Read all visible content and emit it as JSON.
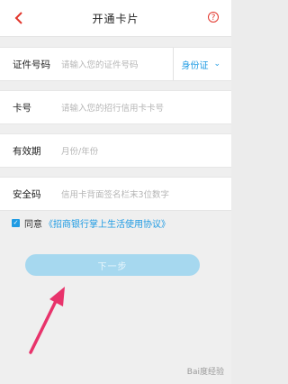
{
  "header": {
    "title": "开通卡片",
    "help_glyph": "?"
  },
  "form": {
    "id_number": {
      "label": "证件号码",
      "placeholder": "请输入您的证件号码",
      "id_type": "身份证"
    },
    "card_number": {
      "label": "卡号",
      "placeholder": "请输入您的招行信用卡卡号"
    },
    "expiry": {
      "label": "有效期",
      "placeholder": "月份/年份"
    },
    "security_code": {
      "label": "安全码",
      "placeholder": "信用卡背面签名栏末3位数字"
    }
  },
  "agreement": {
    "prefix": "同意",
    "link": "《招商银行掌上生活使用协议》",
    "checked": true
  },
  "next_button": {
    "label": "下一步"
  },
  "watermark": {
    "text": "Bai度经验"
  },
  "colors": {
    "accent_blue": "#1f9be3",
    "brand_red": "#e2352b",
    "button_disabled": "#a6d8ef",
    "arrow_pink": "#e8336b"
  }
}
